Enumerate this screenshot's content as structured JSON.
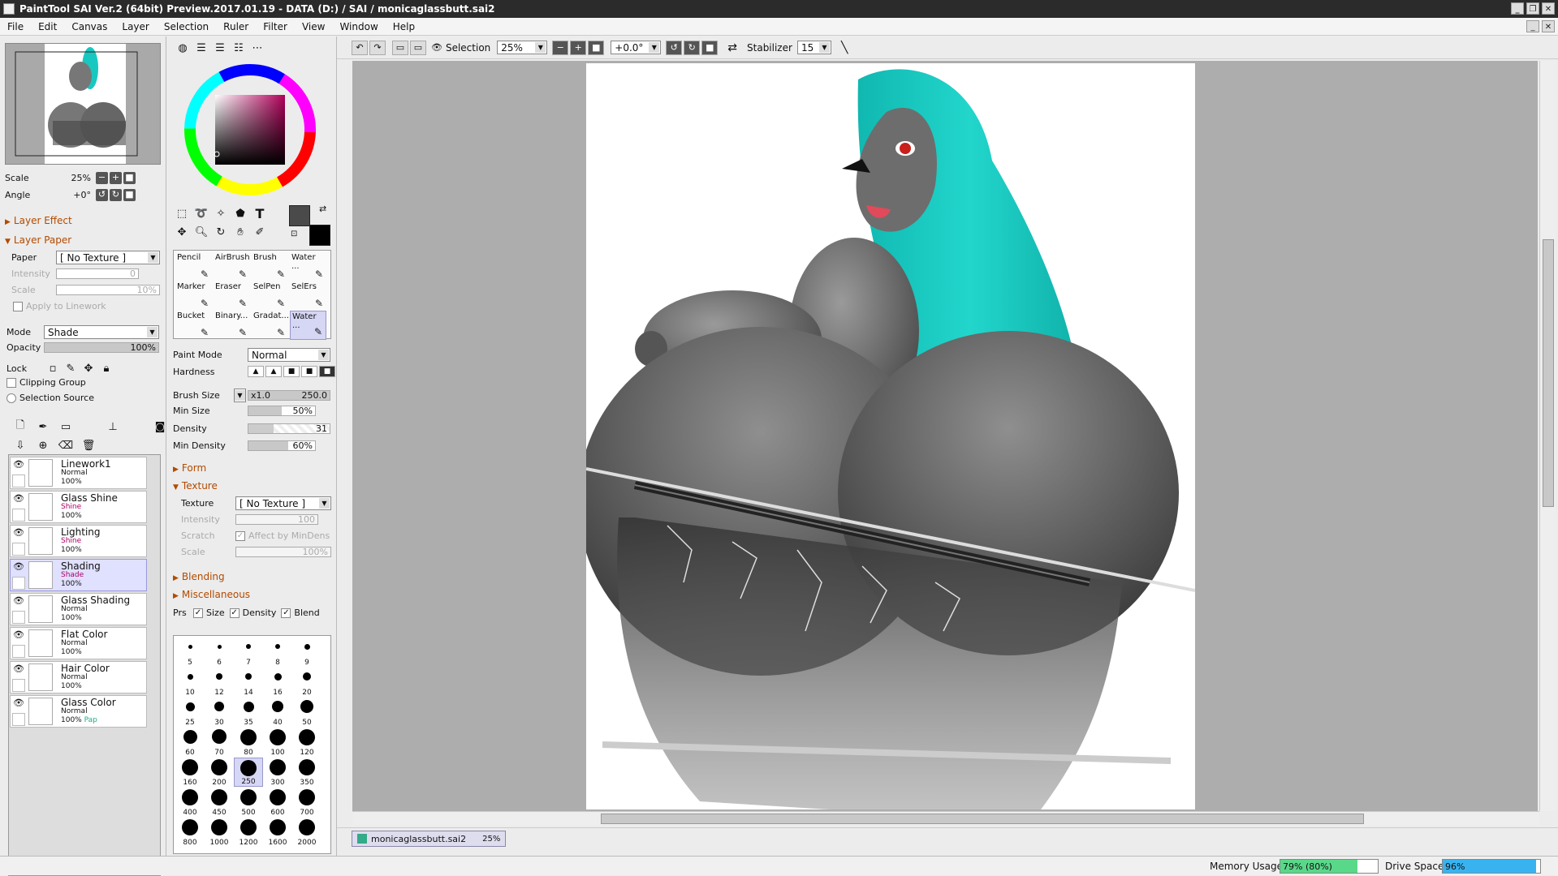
{
  "window": {
    "title": "PaintTool SAI Ver.2 (64bit) Preview.2017.01.19 - DATA (D:) / SAI / monicaglassbutt.sai2",
    "controls": [
      "_",
      "❐",
      "✕"
    ]
  },
  "menu": [
    "File",
    "Edit",
    "Canvas",
    "Layer",
    "Selection",
    "Ruler",
    "Filter",
    "View",
    "Window",
    "Help"
  ],
  "navigator": {
    "scale_label": "Scale",
    "scale_value": "25%",
    "angle_label": "Angle",
    "angle_value": "+0°"
  },
  "layer_effect": {
    "label": "Layer Effect"
  },
  "layer_paper": {
    "label": "Layer Paper",
    "paper_label": "Paper",
    "paper_value": "[ No Texture ]",
    "intensity_label": "Intensity",
    "intensity_value": "0",
    "scale_label": "Scale",
    "scale_value": "10%",
    "apply_label": "Apply to Linework"
  },
  "layer_props": {
    "mode_label": "Mode",
    "mode_value": "Shade",
    "opacity_label": "Opacity",
    "opacity_value": "100%",
    "opacity_fraction": 1.0,
    "lock_label": "Lock",
    "clipping_label": "Clipping Group",
    "selection_source_label": "Selection Source"
  },
  "layers": [
    {
      "name": "Linework1",
      "mode": "Normal",
      "opacity": "100%",
      "selected": false,
      "mode_color": "#111111",
      "extra": ""
    },
    {
      "name": "Glass Shine",
      "mode": "Shine",
      "opacity": "100%",
      "selected": false,
      "mode_color": "#aa0066",
      "extra": ""
    },
    {
      "name": "Lighting",
      "mode": "Shine",
      "opacity": "100%",
      "selected": false,
      "mode_color": "#aa0066",
      "extra": ""
    },
    {
      "name": "Shading",
      "mode": "Shade",
      "opacity": "100%",
      "selected": true,
      "mode_color": "#aa0066",
      "extra": ""
    },
    {
      "name": "Glass Shading",
      "mode": "Normal",
      "opacity": "100%",
      "selected": false,
      "mode_color": "#111111",
      "extra": ""
    },
    {
      "name": "Flat Color",
      "mode": "Normal",
      "opacity": "100%",
      "selected": false,
      "mode_color": "#111111",
      "extra": ""
    },
    {
      "name": "Hair Color",
      "mode": "Normal",
      "opacity": "100%",
      "selected": false,
      "mode_color": "#111111",
      "extra": ""
    },
    {
      "name": "Glass Color",
      "mode": "Normal",
      "opacity": "100%",
      "selected": false,
      "mode_color": "#111111",
      "extra": "Pap"
    }
  ],
  "brushes": [
    {
      "name": "Pencil",
      "selected": false
    },
    {
      "name": "AirBrush",
      "selected": false
    },
    {
      "name": "Brush",
      "selected": false
    },
    {
      "name": "Water ...",
      "selected": false
    },
    {
      "name": "Marker",
      "selected": false
    },
    {
      "name": "Eraser",
      "selected": false
    },
    {
      "name": "SelPen",
      "selected": false
    },
    {
      "name": "SelErs",
      "selected": false
    },
    {
      "name": "Bucket",
      "selected": false
    },
    {
      "name": "Binary...",
      "selected": false
    },
    {
      "name": "Gradat...",
      "selected": false
    },
    {
      "name": "Water ...",
      "selected": true
    }
  ],
  "brush_settings": {
    "paint_mode_label": "Paint Mode",
    "paint_mode_value": "Normal",
    "hardness_label": "Hardness",
    "brush_size_label": "Brush Size",
    "brush_size_mult": "x1.0",
    "brush_size_value": "250.0",
    "min_size_label": "Min Size",
    "min_size_value": "50%",
    "min_size_fraction": 0.5,
    "density_label": "Density",
    "density_value": "31",
    "min_density_label": "Min Density",
    "min_density_value": "60%",
    "min_density_fraction": 0.6,
    "form_label": "Form",
    "texture_label": "Texture",
    "texture_field_label": "Texture",
    "texture_value": "[ No Texture ]",
    "t_intensity_label": "Intensity",
    "t_intensity_value": "100",
    "scratch_label": "Scratch",
    "affect_label": "Affect by MinDens",
    "t_scale_label": "Scale",
    "t_scale_value": "100%",
    "blending_label": "Blending",
    "misc_label": "Miscellaneous",
    "prs_label": "Prs",
    "size_chk": "Size",
    "density_chk": "Density",
    "blend_chk": "Blend"
  },
  "brush_sizes": [
    "5",
    "6",
    "7",
    "8",
    "9",
    "10",
    "12",
    "14",
    "16",
    "20",
    "25",
    "30",
    "35",
    "40",
    "50",
    "60",
    "70",
    "80",
    "100",
    "120",
    "160",
    "200",
    "250",
    "300",
    "350",
    "400",
    "450",
    "500",
    "600",
    "700",
    "800",
    "1000",
    "1200",
    "1600",
    "2000"
  ],
  "selected_size": "250",
  "canvas_toolbar": {
    "selection_label": "Selection",
    "zoom_value": "25%",
    "angle_value": "+0.0°",
    "stabilizer_label": "Stabilizer",
    "stabilizer_value": "15"
  },
  "document_tab": {
    "name": "monicaglassbutt.sai2",
    "zoom": "25%"
  },
  "status": {
    "memory_label": "Memory Usage",
    "memory_value": "79% (80%)",
    "memory_fraction": 0.79,
    "drive_label": "Drive Space",
    "drive_value": "96%",
    "drive_fraction": 0.96
  },
  "colors": {
    "hair": "#18c8c0",
    "memory_fill": "#5ad88a",
    "drive_fill": "#39b3f0",
    "primary": "#4a4a4a",
    "secondary": "#000000"
  }
}
